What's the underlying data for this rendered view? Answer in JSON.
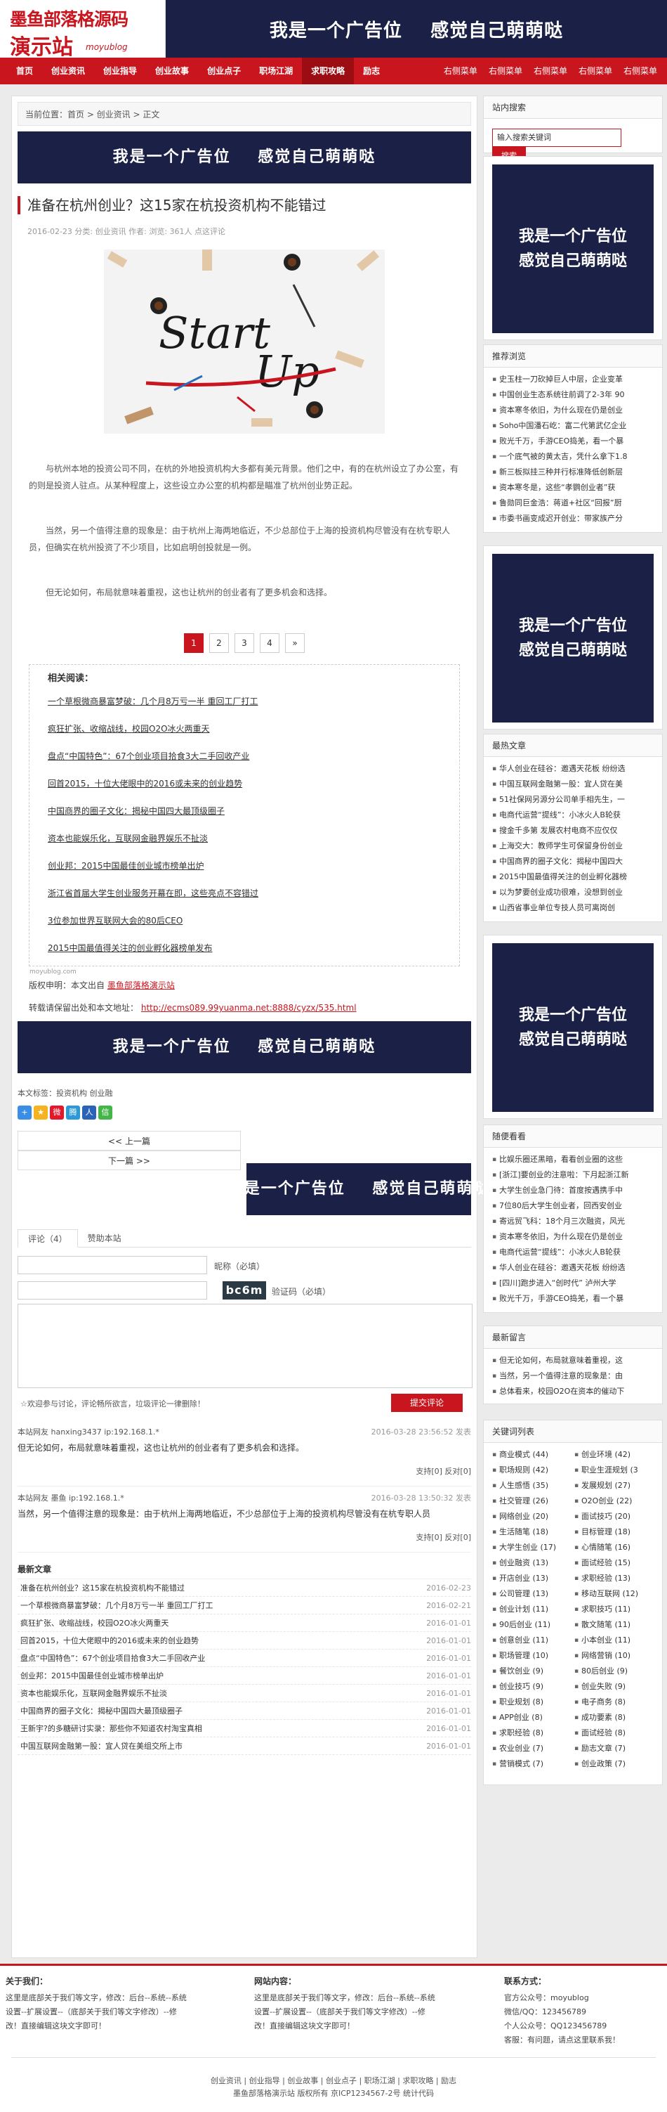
{
  "header": {
    "logo_line1": "墨鱼部落格源码",
    "logo_line2": "演示站",
    "logo_sub": "moyublog",
    "ad_text": "我是一个广告位    感觉自己萌萌哒"
  },
  "nav": {
    "items": [
      "首页",
      "创业资讯",
      "创业指导",
      "创业故事",
      "创业点子",
      "职场江湖",
      "求职攻略",
      "励志"
    ],
    "active_index": 6,
    "right_items": [
      "右侧菜单",
      "右侧菜单",
      "右侧菜单",
      "右侧菜单",
      "右侧菜单"
    ]
  },
  "breadcrumb": "当前位置：首页 > 创业资讯 > 正文",
  "ad_text": "我是一个广告位    感觉自己萌萌哒",
  "side_ad_text_1": "我是一个广告位",
  "side_ad_text_2": "感觉自己萌萌哒",
  "article": {
    "title": "准备在杭州创业？这15家在杭投资机构不能错过",
    "meta": "2016-02-23  分类: 创业资讯  作者: 浏览: 361人  点这评论",
    "hero_word1": "Start",
    "hero_word2": "Up",
    "paragraphs": [
      "与杭州本地的投资公司不同，在杭的外地投资机构大多都有美元背景。他们之中，有的在杭州设立了办公室，有的则是投资人驻点。从某种程度上，这些设立办公室的机构都是瞄准了杭州创业势正起。",
      "当然，另一个值得注意的现象是：由于杭州上海两地临近，不少总部位于上海的投资机构尽管没有在杭专职人员，但确实在杭州投资了不少项目，比如启明创投就是一例。",
      "但无论如何，布局就意味着重视，这也让杭州的创业者有了更多机会和选择。"
    ]
  },
  "pagination": [
    "1",
    "2",
    "3",
    "4",
    "»"
  ],
  "related": {
    "title": "相关阅读：",
    "items": [
      "一个草根微商暴富梦破：几个月8万亏一半 重回工厂打工",
      "疯狂扩张、收缩战线，校园O2O冰火两重天",
      "盘点“中国特色”：67个创业项目拾食3大二手回收产业",
      "回首2015，十位大佬眼中的2016或未来的创业趋势",
      "中国商界的圈子文化：揭秘中国四大最顶级圈子",
      "资本也能娱乐化，互联网金融界娱乐不扯淡",
      "创业邦：2015中国最佳创业城市榜单出炉",
      "浙江省首届大学生创业服务开幕在即，这些亮点不容错过",
      "3位参加世界互联网大会的80后CEO",
      "2015中国最值得关注的创业孵化器榜单发布"
    ],
    "watermark": "moyublog.com"
  },
  "copyright": {
    "label": "版权申明：本文出自",
    "site": "墨鱼部落格演示站",
    "repost_label": "转载请保留出处和本文地址：",
    "url": "http://ecms089.99yuanma.net:8888/cyzx/535.html"
  },
  "tags": "本文标签：投资机构  创业融",
  "prev": "<< 上一篇",
  "next": "下一篇 >>",
  "comment_tabs": [
    "评论（4）",
    "赞助本站"
  ],
  "form": {
    "nick_label": "昵称（必填）",
    "captcha": "bc6m",
    "captcha_label": "验证码（必填）",
    "hint": "☆欢迎参与讨论，评论畅所欲言，垃圾评论一律删除！",
    "submit": "提交评论"
  },
  "comments": [
    {
      "user": "本站网友 hanxing3437 ip:192.168.1.*",
      "date": "2016-03-28 23:56:52 发表",
      "text": "但无论如何，布局就意味着重视，这也让杭州的创业者有了更多机会和选择。",
      "support": "支持[0]  反对[0]"
    },
    {
      "user": "本站网友 墨鱼 ip:192.168.1.*",
      "date": "2016-03-28 13:50:32 发表",
      "text": "当然，另一个值得注意的现象是：由于杭州上海两地临近，不少总部位于上海的投资机构尽管没有在杭专职人员",
      "support": "支持[0]  反对[0]"
    }
  ],
  "newest": {
    "title": "最新文章",
    "items": [
      {
        "t": "准备在杭州创业？这15家在杭投资机构不能错过",
        "d": "2016-02-23"
      },
      {
        "t": "一个草根微商暴富梦破：几个月8万亏一半 重回工厂打工",
        "d": "2016-02-21"
      },
      {
        "t": "疯狂扩张、收缩战线，校园O2O冰火两重天",
        "d": "2016-01-01"
      },
      {
        "t": "回首2015，十位大佬眼中的2016或未来的创业趋势",
        "d": "2016-01-01"
      },
      {
        "t": "盘点“中国特色”：67个创业项目拾食3大二手回收产业",
        "d": "2016-01-01"
      },
      {
        "t": "创业邦：2015中国最佳创业城市榜单出炉",
        "d": "2016-01-01"
      },
      {
        "t": "资本也能娱乐化，互联网金融界娱乐不扯淡",
        "d": "2016-01-01"
      },
      {
        "t": "中国商界的圈子文化：揭秘中国四大最顶级圈子",
        "d": "2016-01-01"
      },
      {
        "t": "王新宇?的多糖研讨实录：那些你不知道农村淘宝真相",
        "d": "2016-01-01"
      },
      {
        "t": "中国互联网金融第一股：宜人贷在美组交所上市",
        "d": "2016-01-01"
      }
    ]
  },
  "sidebar": {
    "search_title": "站内搜索",
    "search_placeholder": "输入搜索关键词",
    "search_button": "搜索",
    "recommend_title": "推荐浏览",
    "recommend": [
      "史玉柱一刀砍掉巨人中层，企业变革",
      "中国创业生态系统往前调了2-3年 90",
      "资本寒冬依旧，为什么现在仍是创业",
      "Soho中国潘石屹：富二代第武亿企业",
      "败光千万，手游CEO捣羌，看一个暴",
      "一个底气被的黄太吉，凭什么拿下1.8",
      "新三板拟挂三种并行标准降低创新层",
      "资本寒冬是，这些“孝鹦创业者”获",
      "鲁勋同巨金浩：蒋道+社区“回报”厨",
      "市委书画变成迟开创业：带家族产分"
    ],
    "latest_title": "最热文章",
    "latest": [
      "华人创业在硅谷：邀遇天花板 纷纷选",
      "中国互联网金融第一股：宜人贷在美",
      "51社保网另源分公司单手相先生，一",
      "电商代运营“提线”：小冰火人B轮获",
      "搜金千多第 发展农村电商不应仅仅",
      "上海交大：教师学生可保留身份创业",
      "中国商界的圈子文化：揭秘中国四大",
      "2015中国最值得关注的创业孵化器榜",
      "以为梦要创业成功很难，没想到创业",
      "山西省事业单位专技人员可离岗创"
    ],
    "random_title": "随便看看",
    "random": [
      "比娱乐圈还黑暗，看看创业圈的这些",
      "[浙江]要创业的注意啦：下月起浙江新",
      "大学生创业急门待：首度按遇携手中",
      "7位80后大学生创业者，回西安创业",
      "寄远贸飞科：18个月三次融资，风光",
      "资本寒冬依旧，为什么现在仍是创业",
      "电商代运营“提线”：小冰火人B轮获",
      "华人创业在硅谷：邀遇天花板 纷纷选",
      "[四川]跑步进入“创时代” 泸州大学",
      "败光千万，手游CEO捣羌，看一个暴"
    ],
    "comments_title": "最新留言",
    "comments": [
      "但无论如何，布局就意味着重视，这",
      "当然，另一个值得注意的现象是：由",
      "总体看来，校园O2O在资本的催动下"
    ],
    "keywords_title": "关键词列表",
    "keywords": [
      "商业模式 (44)",
      "创业环境 (42)",
      "职场规则 (42)",
      "职业生涯规划 (3",
      "人生感悟 (35)",
      "发展规划 (27)",
      "社交管理 (26)",
      "O2O创业 (22)",
      "网络创业 (20)",
      "面试技巧 (20)",
      "生活随笔 (18)",
      "目标管理 (18)",
      "大学生创业 (17)",
      "心情随笔 (16)",
      "创业融资 (13)",
      "面试经验 (15)",
      "开店创业 (13)",
      "求职经验 (13)",
      "公司管理 (13)",
      "移动互联网 (12)",
      "创业计划 (11)",
      "求职技巧 (11)",
      "90后创业 (11)",
      "散文随笔 (11)",
      "创意创业 (11)",
      "小本创业 (11)",
      "职场管理 (10)",
      "网络营销 (10)",
      "餐饮创业 (9)",
      "80后创业 (9)",
      "创业技巧 (9)",
      "创业失败 (9)",
      "职业规划 (8)",
      "电子商务 (8)",
      "APP创业 (8)",
      "成功要素 (8)",
      "求职经验 (8)",
      "面试经验 (8)",
      "农业创业 (7)",
      "励志文章 (7)",
      "营销模式 (7)",
      "创业政策 (7)"
    ]
  },
  "footer": {
    "about_title": "关于我们：",
    "about_text": "这里是底部关于我们等文字，修改：后台--系统--系统设置--扩展设置--（底部关于我们等文字修改）--修改！直接编辑这块文字即可！",
    "content_title": "网站内容：",
    "content_text": "这里是底部关于我们等文字，修改：后台--系统--系统设置--扩展设置--（底部关于我们等文字修改）--修改！直接编辑这块文字即可！",
    "contact_title": "联系方式：",
    "contact_lines": [
      "官方公众号：moyublog",
      "微信/QQ：123456789",
      "个人公众号：QQ123456789",
      "客服：有问题，请点这里联系我！"
    ],
    "links": "创业资讯 | 创业指导 | 创业故事 | 创业点子 | 职场江湖 | 求职攻略 | 励志",
    "icp": "墨鱼部落格演示站 版权所有 京ICP1234567-2号 统计代码"
  }
}
